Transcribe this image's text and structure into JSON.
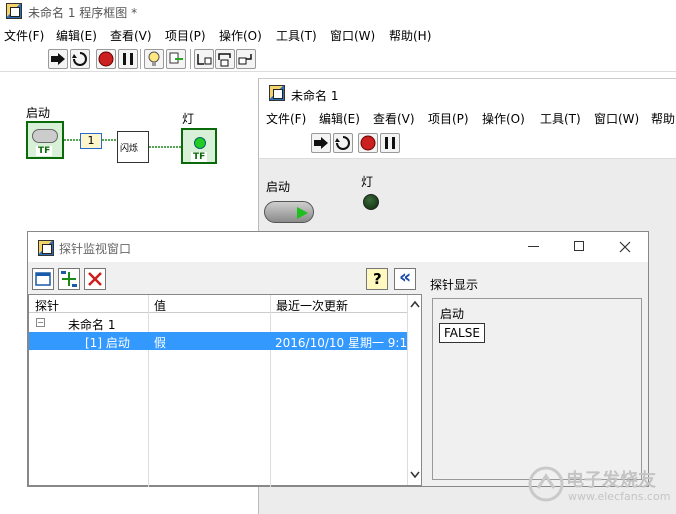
{
  "diagram_window": {
    "title": "未命名 1 程序框图 *",
    "menu": [
      "文件(F)",
      "编辑(E)",
      "查看(V)",
      "项目(P)",
      "操作(O)",
      "工具(T)",
      "窗口(W)",
      "帮助(H)"
    ],
    "nodes": {
      "start_label": "启动",
      "start_terminal": "TF",
      "constant_value": "1",
      "blink_label": "闪烁",
      "lamp_label": "灯",
      "lamp_terminal": "TF"
    }
  },
  "front_window": {
    "title": "未命名 1",
    "menu": [
      "文件(F)",
      "编辑(E)",
      "查看(V)",
      "项目(P)",
      "操作(O)",
      "工具(T)",
      "窗口(W)",
      "帮助"
    ],
    "start_label": "启动",
    "lamp_label": "灯"
  },
  "probe_window": {
    "title": "探针监视窗口",
    "columns": [
      "探针",
      "值",
      "最近一次更新"
    ],
    "tree_root": "未命名 1",
    "rows": [
      {
        "probe": "[1] 启动",
        "value": "假",
        "updated": "2016/10/10 星期一 9:1("
      }
    ],
    "display_header": "探针显示",
    "display_label": "启动",
    "display_value": "FALSE",
    "help_symbol": "?",
    "collapse_symbol": "«"
  },
  "watermark": {
    "text": "电子发烧友",
    "url": "www.elecfans.com"
  },
  "colors": {
    "selection": "#3399ff",
    "lamp_green": "#22cc22",
    "button_green": "#1fbf1f",
    "stop_red": "#cc1f1f"
  }
}
